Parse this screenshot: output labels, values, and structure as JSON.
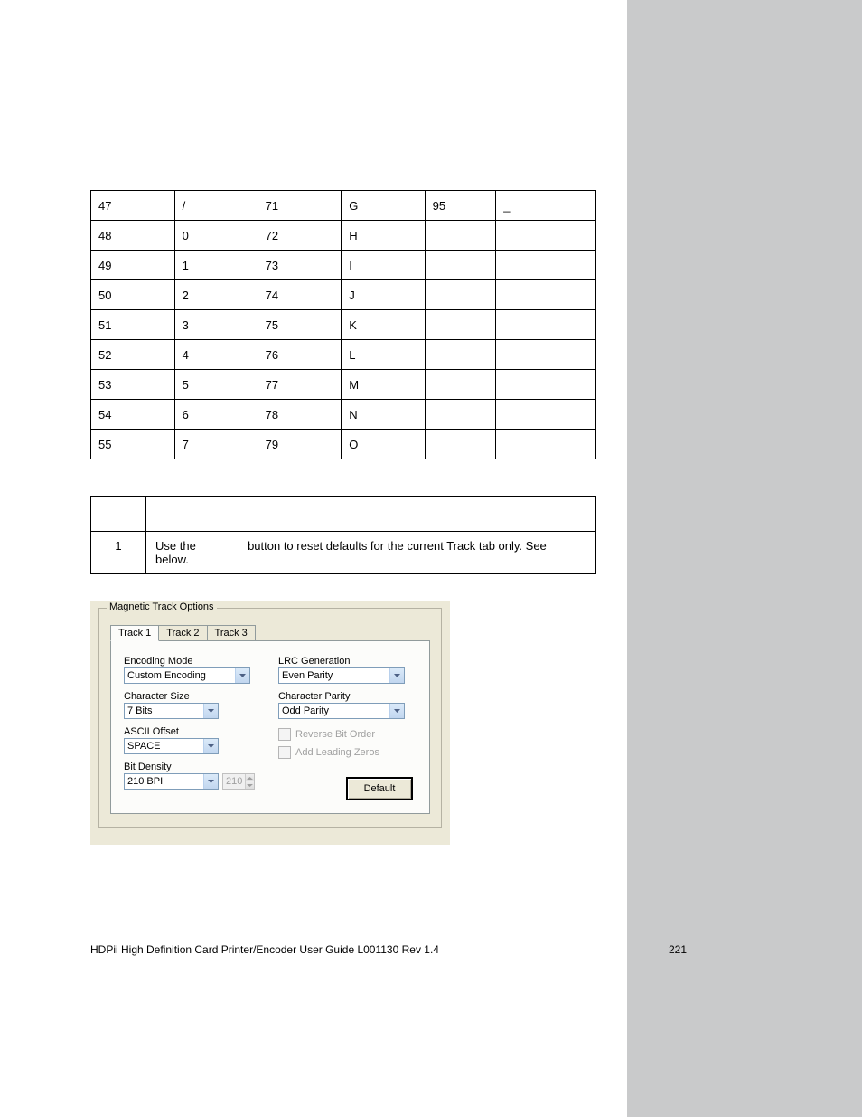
{
  "ascii_table": {
    "rows": [
      [
        "47",
        "/",
        "71",
        "G",
        "95",
        "_"
      ],
      [
        "48",
        "0",
        "72",
        "H",
        "",
        ""
      ],
      [
        "49",
        "1",
        "73",
        "I",
        "",
        ""
      ],
      [
        "50",
        "2",
        "74",
        "J",
        "",
        ""
      ],
      [
        "51",
        "3",
        "75",
        "K",
        "",
        ""
      ],
      [
        "52",
        "4",
        "76",
        "L",
        "",
        ""
      ],
      [
        "53",
        "5",
        "77",
        "M",
        "",
        ""
      ],
      [
        "54",
        "6",
        "78",
        "N",
        "",
        ""
      ],
      [
        "55",
        "7",
        "79",
        "O",
        "",
        ""
      ]
    ]
  },
  "step_table": {
    "num": "1",
    "text_a": "Use the",
    "text_b": "button to reset defaults for the current Track tab only. See",
    "text_c": "below."
  },
  "dialog": {
    "group_title": "Magnetic Track Options",
    "tabs": [
      "Track 1",
      "Track 2",
      "Track 3"
    ],
    "labels": {
      "encoding_mode": "Encoding Mode",
      "character_size": "Character Size",
      "ascii_offset": "ASCII Offset",
      "bit_density": "Bit Density",
      "lrc_generation": "LRC Generation",
      "character_parity": "Character Parity",
      "reverse_bit_order": "Reverse Bit Order",
      "add_leading_zeros": "Add Leading Zeros"
    },
    "values": {
      "encoding_mode": "Custom Encoding",
      "character_size": "7 Bits",
      "ascii_offset": "SPACE",
      "bit_density": "210 BPI",
      "bit_density_num": "210",
      "lrc_generation": "Even Parity",
      "character_parity": "Odd Parity"
    },
    "default_button": "Default"
  },
  "footer": {
    "left": "HDPii High Definition Card Printer/Encoder User Guide    L001130 Rev 1.4",
    "page": "221"
  }
}
